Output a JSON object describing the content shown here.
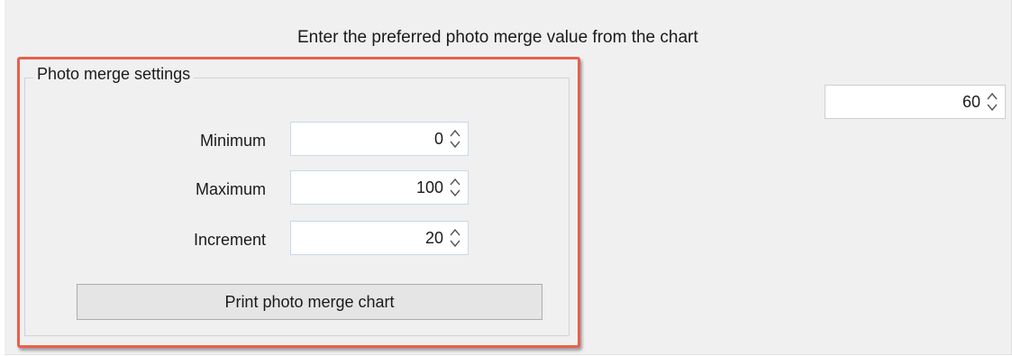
{
  "instruction_text": "Enter the preferred photo merge value from the chart",
  "preferred_value": "60",
  "group": {
    "title": "Photo merge settings",
    "fields": [
      {
        "label": "Minimum",
        "value": "0"
      },
      {
        "label": "Maximum",
        "value": "100"
      },
      {
        "label": "Increment",
        "value": "20"
      }
    ],
    "print_button_label": "Print photo merge chart"
  },
  "highlight_color": "#e8604c",
  "icons": {
    "spinner": "up-down-chevron-icon"
  }
}
